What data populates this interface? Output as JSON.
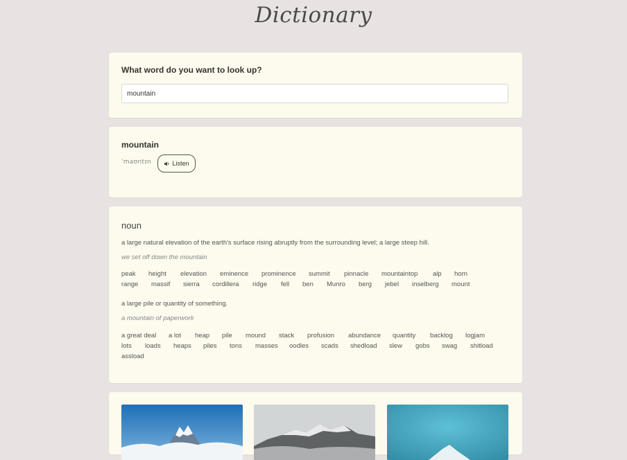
{
  "app": {
    "title": "Dictionary"
  },
  "search": {
    "question": "What word do you want to look up?",
    "value": "mountain"
  },
  "word": {
    "text": "mountain",
    "phonetic": "ˈmaʊntɪn",
    "listen_label": "Listen"
  },
  "meaning": {
    "part_of_speech": "noun",
    "definitions": [
      {
        "definition": "a large natural elevation of the earth's surface rising abruptly from the surrounding level; a large steep hill.",
        "example": "we set off down the mountain",
        "synonyms": [
          [
            "peak",
            "height",
            "elevation",
            "eminence",
            "prominence",
            "summit",
            "pinnacle",
            "mountaintop",
            "alp",
            "horn"
          ],
          [
            "range",
            "massif",
            "sierra",
            "cordillera",
            "ridge",
            "fell",
            "ben",
            "Munro",
            "berg",
            "jebel",
            "inselberg",
            "mount"
          ]
        ]
      },
      {
        "definition": "a large pile or quantity of something.",
        "example": "a mountain of paperwork",
        "synonyms": [
          [
            "a great deal",
            "a lot",
            "heap",
            "pile",
            "mound",
            "stack",
            "profusion",
            "abundance",
            "quantity",
            "backlog",
            "logjam"
          ],
          [
            "lots",
            "loads",
            "heaps",
            "piles",
            "tons",
            "masses",
            "oodles",
            "scads",
            "shedload",
            "slew",
            "gobs",
            "swag",
            "shitload"
          ],
          [
            "assload"
          ]
        ]
      }
    ]
  },
  "photos": [
    {
      "name": "mountain-photo-1",
      "sky": "#2f7fc0",
      "ground": "#e9eef4"
    },
    {
      "name": "mountain-photo-2",
      "sky": "#c8cccc",
      "ground": "#6b6f70"
    },
    {
      "name": "mountain-photo-3",
      "sky": "#3aa0b8",
      "ground": "#5fb9cf"
    }
  ],
  "icons": {
    "listen": "speaker-icon"
  },
  "colors": {
    "page_bg": "#e8e2e2",
    "card_bg": "#fcfbed"
  }
}
